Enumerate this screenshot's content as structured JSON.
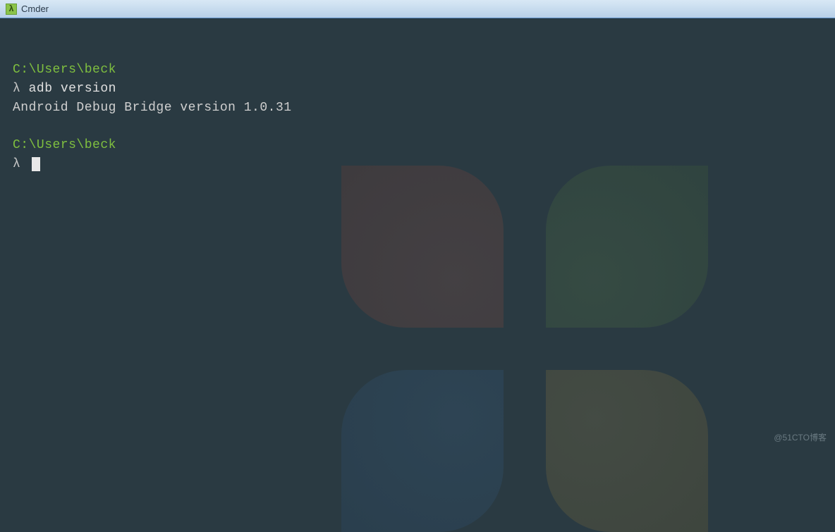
{
  "window": {
    "icon_char": "λ",
    "title": "Cmder"
  },
  "terminal": {
    "blocks": [
      {
        "path": "C:\\Users\\beck",
        "lambda": "λ",
        "command": "adb version",
        "output": "Android Debug Bridge version 1.0.31"
      },
      {
        "path": "C:\\Users\\beck",
        "lambda": "λ",
        "command": "",
        "output": ""
      }
    ]
  },
  "watermark": "@51CTO博客"
}
